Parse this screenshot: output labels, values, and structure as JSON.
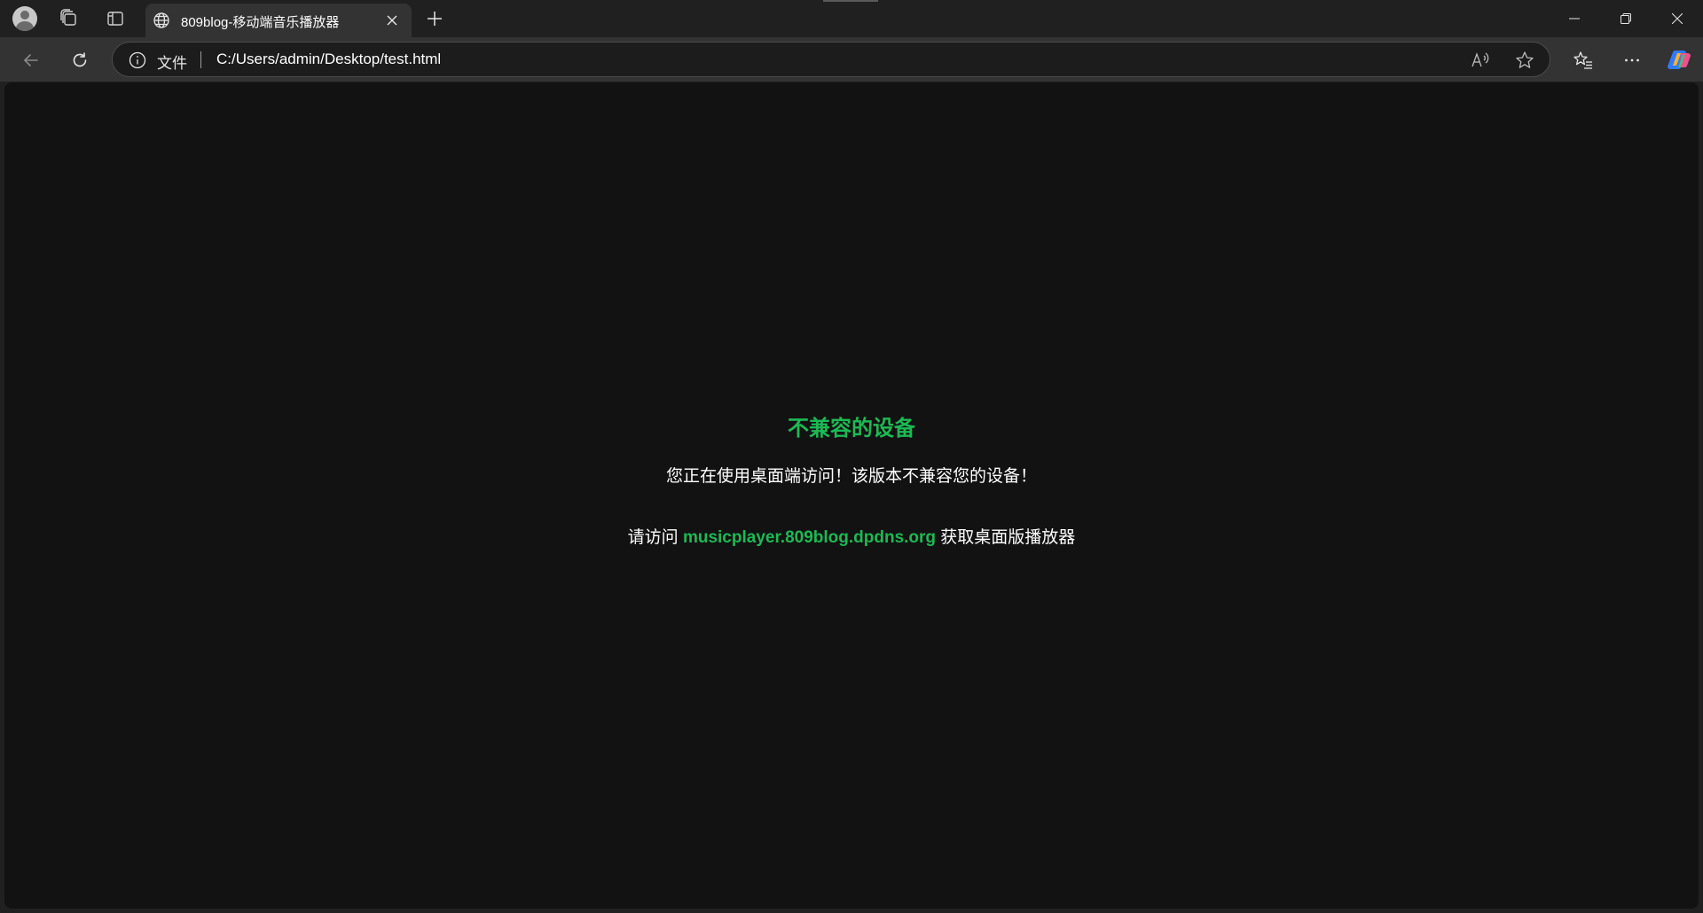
{
  "browser": {
    "tab": {
      "title": "809blog-移动端音乐播放器"
    },
    "address": {
      "scheme_label": "文件",
      "url": "C:/Users/admin/Desktop/test.html"
    },
    "icons": {
      "profile": "avatar-icon",
      "workspaces": "workspaces-icon",
      "vertical_tabs": "vertical-tabs-icon",
      "favicon": "globe-icon",
      "close_tab": "close-icon",
      "new_tab": "plus-icon",
      "back": "back-arrow-icon",
      "refresh": "refresh-icon",
      "site_info": "info-icon",
      "read_aloud": "read-aloud-icon",
      "favorite": "star-icon",
      "favorites": "favorites-icon",
      "more": "more-icon",
      "copilot": "copilot-icon"
    }
  },
  "page": {
    "title": "不兼容的设备",
    "message": "您正在使用桌面端访问！该版本不兼容您的设备！",
    "visit_prefix": "请访问 ",
    "visit_link": "musicplayer.809blog.dpdns.org",
    "visit_suffix": " 获取桌面版播放器"
  },
  "colors": {
    "accent_green": "#1db954",
    "page_background": "#121212",
    "toolbar": "#333333",
    "tabstrip": "#202020"
  }
}
